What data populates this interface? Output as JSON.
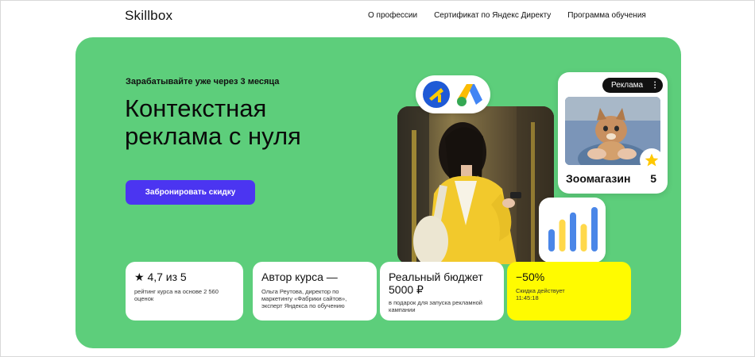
{
  "header": {
    "logo": "Skillbox",
    "nav": [
      {
        "label": "О профессии"
      },
      {
        "label": "Сертификат по Яндекс Директу"
      },
      {
        "label": "Программа обучения"
      }
    ]
  },
  "hero": {
    "eyebrow": "Зарабатывайте уже через 3 месяца",
    "title_line1": "Контекстная",
    "title_line2": "реклама с нуля",
    "cta_label": "Забронировать скидку",
    "ad_card": {
      "badge": "Реклама",
      "name": "Зоомагазин",
      "rating": "5"
    },
    "bars": [
      {
        "color": "#4a86e8",
        "level": 0.5
      },
      {
        "color": "#ffd84a",
        "level": 0.72
      },
      {
        "color": "#4a86e8",
        "level": 0.88
      },
      {
        "color": "#ffd84a",
        "level": 0.62
      },
      {
        "color": "#4a86e8",
        "level": 1.0
      }
    ]
  },
  "cards": [
    {
      "heading": "★ 4,7 из 5",
      "sub": "рейтинг курса на основе 2 560 оценок"
    },
    {
      "heading": "Автор курса —",
      "sub": "Ольга Реутова, директор по маркетингу «Фабрики сайтов», эксперт Яндекса по обучению"
    },
    {
      "heading_line1": "Реальный бюджет",
      "heading_line2": "5000 ₽",
      "sub": "в подарок для запуска рекламной кампании"
    },
    {
      "heading": "−50%",
      "sub_line1": "Скидка действует",
      "sub_line2": "11:45:18"
    }
  ],
  "colors": {
    "hero_bg": "#5dce7b",
    "cta_bg": "#4b35f1",
    "promo_bg": "#fffb00"
  }
}
